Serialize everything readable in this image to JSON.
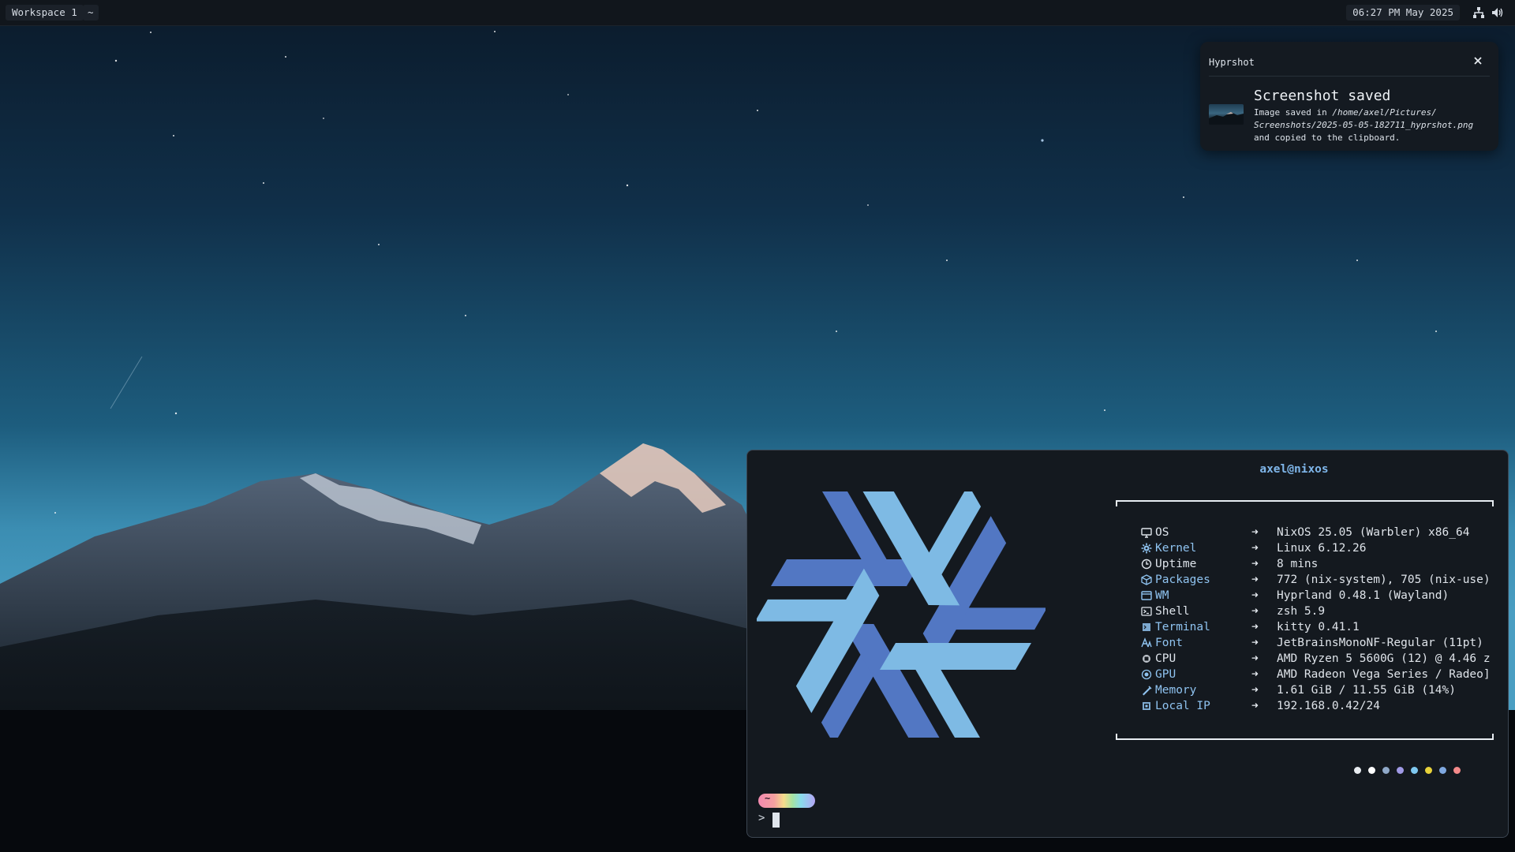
{
  "topbar": {
    "workspace_label": "Workspace 1",
    "tilde_label": "~",
    "clock": "06:27 PM May 2025",
    "tray_icons": [
      "network-icon",
      "volume-icon"
    ]
  },
  "notification": {
    "app_name": "Hyprshot",
    "summary": "Screenshot saved",
    "body_prefix": "Image saved in ",
    "body_path": "/home/axel/Pictures/ Screenshots/2025-05-05-182711_hyprshot.png",
    "body_suffix": " and copied to the clipboard."
  },
  "terminal": {
    "user_host": "axel@nixos",
    "logo": "nixos-snowflake-logo",
    "info": [
      {
        "icon": "monitor-icon",
        "key": "OS",
        "value": "NixOS 25.05 (Warbler) x86_64",
        "key_color": "#dfe5ec",
        "icon_color": "#dfe5ec"
      },
      {
        "icon": "gear-icon",
        "key": "Kernel",
        "value": "Linux 6.12.26",
        "key_color": "#8fc3f0",
        "icon_color": "#8fc3f0"
      },
      {
        "icon": "clock-icon",
        "key": "Uptime",
        "value": "8 mins",
        "key_color": "#dfe5ec",
        "icon_color": "#dfe5ec"
      },
      {
        "icon": "package-icon",
        "key": "Packages",
        "value": "772 (nix-system), 705 (nix-use)",
        "key_color": "#8fc3f0",
        "icon_color": "#8fc3f0"
      },
      {
        "icon": "window-icon",
        "key": "WM",
        "value": "Hyprland 0.48.1 (Wayland)",
        "key_color": "#8fc3f0",
        "icon_color": "#8fc3f0"
      },
      {
        "icon": "shell-icon",
        "key": "Shell",
        "value": "zsh 5.9",
        "key_color": "#dfe5ec",
        "icon_color": "#dfe5ec"
      },
      {
        "icon": "terminal-icon",
        "key": "Terminal",
        "value": "kitty 0.41.1",
        "key_color": "#8fc3f0",
        "icon_color": "#8fc3f0"
      },
      {
        "icon": "font-icon",
        "key": "Font",
        "value": "JetBrainsMonoNF-Regular (11pt)",
        "key_color": "#8fc3f0",
        "icon_color": "#8fc3f0"
      },
      {
        "icon": "cpu-icon",
        "key": "CPU",
        "value": "AMD Ryzen 5 5600G (12) @ 4.46 z",
        "key_color": "#dfe5ec",
        "icon_color": "#dfe5ec"
      },
      {
        "icon": "gpu-icon",
        "key": "GPU",
        "value": "AMD Radeon Vega Series / Radeo]",
        "key_color": "#8fc3f0",
        "icon_color": "#8fc3f0"
      },
      {
        "icon": "memory-icon",
        "key": "Memory",
        "value": "1.61 GiB / 11.55 GiB (14%)",
        "key_color": "#8fc3f0",
        "icon_color": "#8fc3f0"
      },
      {
        "icon": "network-card-icon",
        "key": "Local IP",
        "value": "192.168.0.42/24",
        "key_color": "#8fc3f0",
        "icon_color": "#8fc3f0"
      }
    ],
    "arrow": "➜",
    "palette": [
      "#e8ecf0",
      "#ffffff",
      "#8fa8c8",
      "#a09ae6",
      "#7fc8f0",
      "#e8d23a",
      "#7fa8e0",
      "#f48a8a"
    ],
    "prompt_tilde": "~",
    "prompt_symbol": ">"
  },
  "colors": {
    "nix_dark_blue": "#5277c3",
    "nix_light_blue": "#7ebae4",
    "accent_user": "#7fb6ea"
  }
}
